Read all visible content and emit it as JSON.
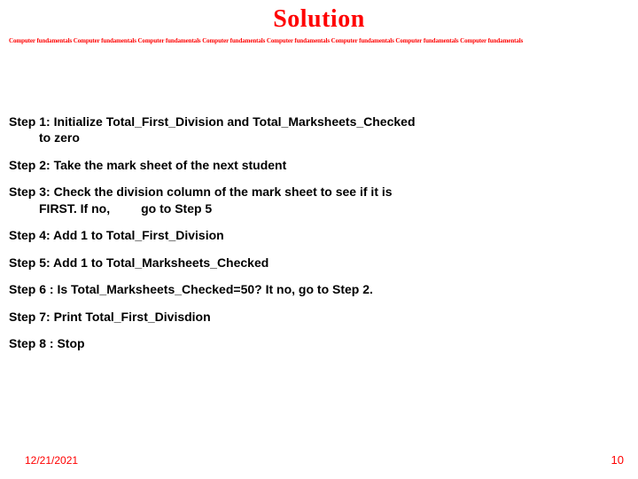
{
  "title": "Solution",
  "tagline": "Computer fundamentals Computer fundamentals Computer fundamentals Computer fundamentals Computer fundamentals Computer fundamentals Computer fundamentals Computer fundamentals",
  "steps": {
    "s1a": "Step 1: Initialize Total_First_Division and Total_Marksheets_Checked",
    "s1b": "to zero",
    "s2": "Step 2: Take the mark sheet of the next student",
    "s3a": "Step 3: Check the division column of the mark sheet to see if it is",
    "s3b": "FIRST. If no,         go to Step 5",
    "s4": "Step 4: Add 1 to Total_First_Division",
    "s5": "Step 5: Add 1 to Total_Marksheets_Checked",
    "s6": "Step 6 : Is Total_Marksheets_Checked=50? It no, go to Step 2.",
    "s7": "Step 7: Print Total_First_Divisdion",
    "s8": "Step 8 : Stop"
  },
  "footer": {
    "date": "12/21/2021",
    "page": "10"
  }
}
